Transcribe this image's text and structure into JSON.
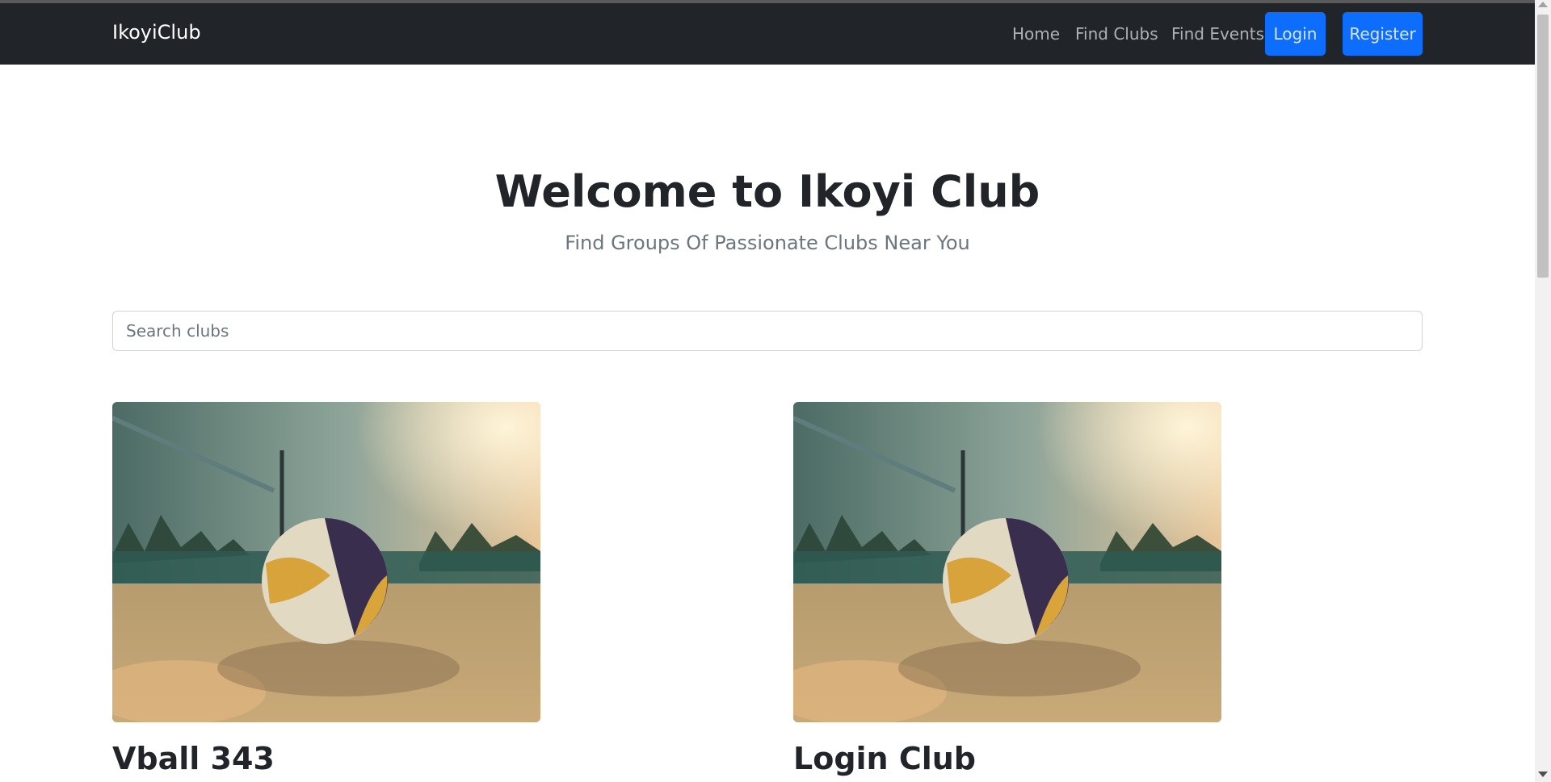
{
  "navbar": {
    "brand": "IkoyiClub",
    "links": [
      {
        "label": "Home"
      },
      {
        "label": "Find Clubs"
      },
      {
        "label": "Find Events"
      }
    ],
    "login_label": "Login",
    "register_label": "Register"
  },
  "hero": {
    "title": "Welcome to Ikoyi Club",
    "subtitle": "Find Groups Of Passionate Clubs Near You"
  },
  "search": {
    "placeholder": "Search clubs",
    "value": ""
  },
  "clubs": [
    {
      "title": "Vball 343",
      "image": "volleyball-on-beach-sand"
    },
    {
      "title": "Login Club",
      "image": "volleyball-on-beach-sand"
    }
  ],
  "colors": {
    "navbar_bg": "#212529",
    "primary_button": "#0d6efd",
    "heading_text": "#212529",
    "muted_text": "#6c757d"
  }
}
